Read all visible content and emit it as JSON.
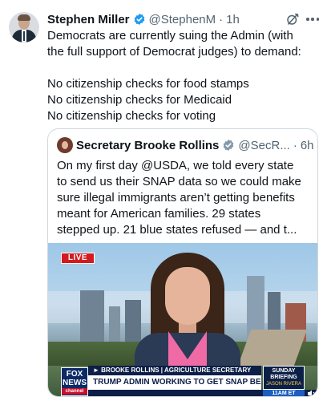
{
  "tweet": {
    "author_name": "Stephen Miller",
    "author_handle": "@StephenM",
    "separator": "·",
    "time": "1h",
    "body_lines": [
      "Democrats are currently suing the Admin (with",
      "the full support of Democrat judges) to demand:",
      "",
      "No citizenship checks for food stamps",
      "No citizenship checks for Medicaid",
      "No citizenship checks for voting"
    ]
  },
  "quote": {
    "author_name": "Secretary Brooke Rollins",
    "author_handle": "@SecR...",
    "separator": "·",
    "time": "6h",
    "text_lines": [
      "On my first day @USDA, we told every state",
      "to send us their SNAP data so we could make",
      "sure illegal immigrants aren’t getting benefits",
      "meant for American families. 29 states",
      "stepped up. 21 blue states refused — and t..."
    ]
  },
  "media": {
    "live_badge": "LIVE",
    "network_logo_top": "FOX",
    "network_logo_mid": "NEWS",
    "network_logo_bottom": "channel",
    "chyron_top": "► BROOKE ROLLINS | AGRICULTURE SECRETARY",
    "chyron_main": "TRUMP ADMIN WORKING TO GET SNAP BENEFITS FUNDED",
    "show_name": "SUNDAY BRIEFING",
    "show_host": "JASON RIVERA",
    "clock": "11AM ET"
  },
  "icons": {
    "verified": "verified-badge-icon",
    "grok": "grok-icon",
    "more": "more-options-icon",
    "speaker": "speaker-icon"
  },
  "colors": {
    "verified_blue": "#1d9bf0",
    "secondary_text": "#536471",
    "live_red": "#d31a1f",
    "fox_navy": "#0c1f47"
  }
}
